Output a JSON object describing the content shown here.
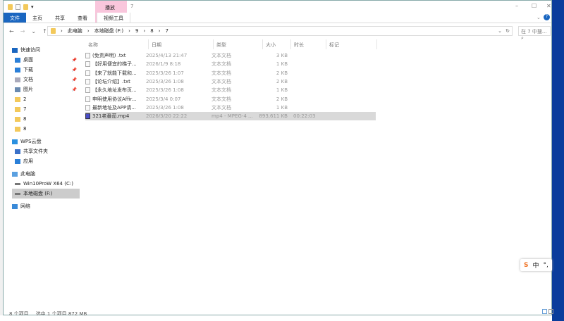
{
  "window": {
    "title": "7",
    "context_tab": "播放"
  },
  "ribbon": {
    "tabs": [
      "文件",
      "主页",
      "共享",
      "查看",
      "视频工具"
    ]
  },
  "address": {
    "crumbs": [
      "此电脑",
      "本地磁盘 (F:)",
      "9",
      "8",
      "7"
    ],
    "search_placeholder": "在 7 中搜..."
  },
  "sidebar": {
    "items": [
      {
        "label": "快速访问",
        "icon": "star-icon"
      },
      {
        "label": "桌面",
        "icon": "desktop-icon",
        "pinned": true
      },
      {
        "label": "下载",
        "icon": "download-icon",
        "pinned": true
      },
      {
        "label": "文档",
        "icon": "document-icon",
        "pinned": true
      },
      {
        "label": "图片",
        "icon": "picture-icon",
        "pinned": true
      },
      {
        "label": "2",
        "icon": "folder-icon"
      },
      {
        "label": "7",
        "icon": "folder-icon"
      },
      {
        "label": "8",
        "icon": "folder-icon"
      },
      {
        "label": "8",
        "icon": "folder-icon"
      },
      {
        "label": "WPS云盘",
        "icon": "cloud-icon"
      },
      {
        "label": "共享文件夹",
        "icon": "share-icon"
      },
      {
        "label": "应用",
        "icon": "apps-icon"
      },
      {
        "label": "此电脑",
        "icon": "computer-icon"
      },
      {
        "label": "Win10ProW X64 (C:)",
        "icon": "drive-icon"
      },
      {
        "label": "本地磁盘 (F:)",
        "icon": "drive-icon"
      },
      {
        "label": "网络",
        "icon": "network-icon"
      }
    ]
  },
  "columns": [
    "名称",
    "日期",
    "类型",
    "大小",
    "时长",
    "标记"
  ],
  "files": [
    {
      "name": "(免责声明) .txt",
      "date": "2025/4/13 21:47",
      "type": "文本文档",
      "size": "3 KB",
      "duration": ""
    },
    {
      "name": "【好用便宜的梯子...",
      "date": "2026/1/9 8:18",
      "type": "文本文档",
      "size": "1 KB",
      "duration": ""
    },
    {
      "name": "【来了就能下载和...",
      "date": "2025/3/26 1:07",
      "type": "文本文档",
      "size": "2 KB",
      "duration": ""
    },
    {
      "name": "【论坛介绍】.txt",
      "date": "2025/3/26 1:08",
      "type": "文本文档",
      "size": "2 KB",
      "duration": ""
    },
    {
      "name": "【永久地址发布页...",
      "date": "2025/3/26 1:08",
      "type": "文本文档",
      "size": "1 KB",
      "duration": ""
    },
    {
      "name": "申明使用协议Affir...",
      "date": "2025/3/4 0:07",
      "type": "文本文档",
      "size": "2 KB",
      "duration": ""
    },
    {
      "name": "最新地址及APP请...",
      "date": "2025/3/26 1:08",
      "type": "文本文档",
      "size": "1 KB",
      "duration": ""
    },
    {
      "name": "321老番茄.mp4",
      "date": "2026/3/20 22:22",
      "type": "mp4 - MPEG-4 ...",
      "size": "893,611 KB",
      "duration": "00:22:03"
    }
  ],
  "status": {
    "count": "8 个项目",
    "selected": "选中 1 个项目 872 MB"
  },
  "ime": {
    "mode": "中",
    "punct": "°,"
  }
}
